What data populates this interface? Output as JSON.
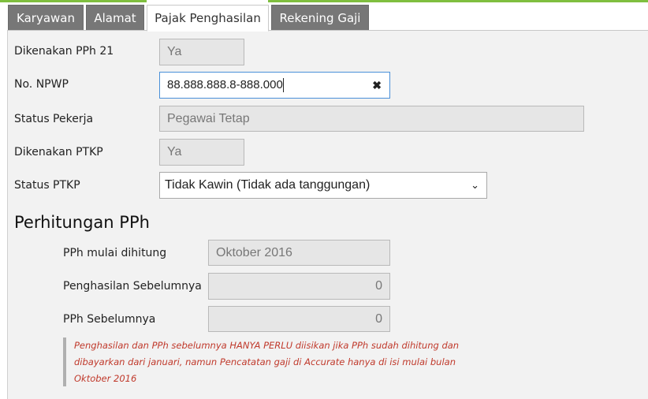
{
  "tabs": [
    {
      "label": "Karyawan",
      "active": false
    },
    {
      "label": "Alamat",
      "active": false
    },
    {
      "label": "Pajak Penghasilan",
      "active": true
    },
    {
      "label": "Rekening Gaji",
      "active": false
    }
  ],
  "form": {
    "pph21_label": "Dikenakan PPh 21",
    "pph21_value": "Ya",
    "npwp_label": "No. NPWP",
    "npwp_value": "88.888.888.8-888.000",
    "status_pekerja_label": "Status Pekerja",
    "status_pekerja_value": "Pegawai Tetap",
    "ptkp_label": "Dikenakan PTKP",
    "ptkp_value": "Ya",
    "status_ptkp_label": "Status PTKP",
    "status_ptkp_value": "Tidak Kawin (Tidak ada tanggungan)"
  },
  "perhitungan": {
    "title": "Perhitungan PPh",
    "mulai_label": "PPh mulai dihitung",
    "mulai_value": "Oktober 2016",
    "penghasilan_label": "Penghasilan Sebelumnya",
    "penghasilan_value": "0",
    "pph_label": "PPh Sebelumnya",
    "pph_value": "0",
    "note_line1": "Penghasilan dan PPh sebelumnya HANYA PERLU diisikan jika PPh sudah dihitung dan",
    "note_line2": "dibayarkan dari januari, namun Pencatatan gaji di Accurate hanya di isi mulai bulan",
    "note_line3": "Oktober 2016"
  },
  "icons": {
    "clear": "clear-icon",
    "dropdown": "chevron-down-icon"
  },
  "colors": {
    "tab_inactive": "#777777",
    "top_accent": "#7fbf3f",
    "note_text": "#c0392b",
    "input_focus_border": "#4a90d9"
  }
}
